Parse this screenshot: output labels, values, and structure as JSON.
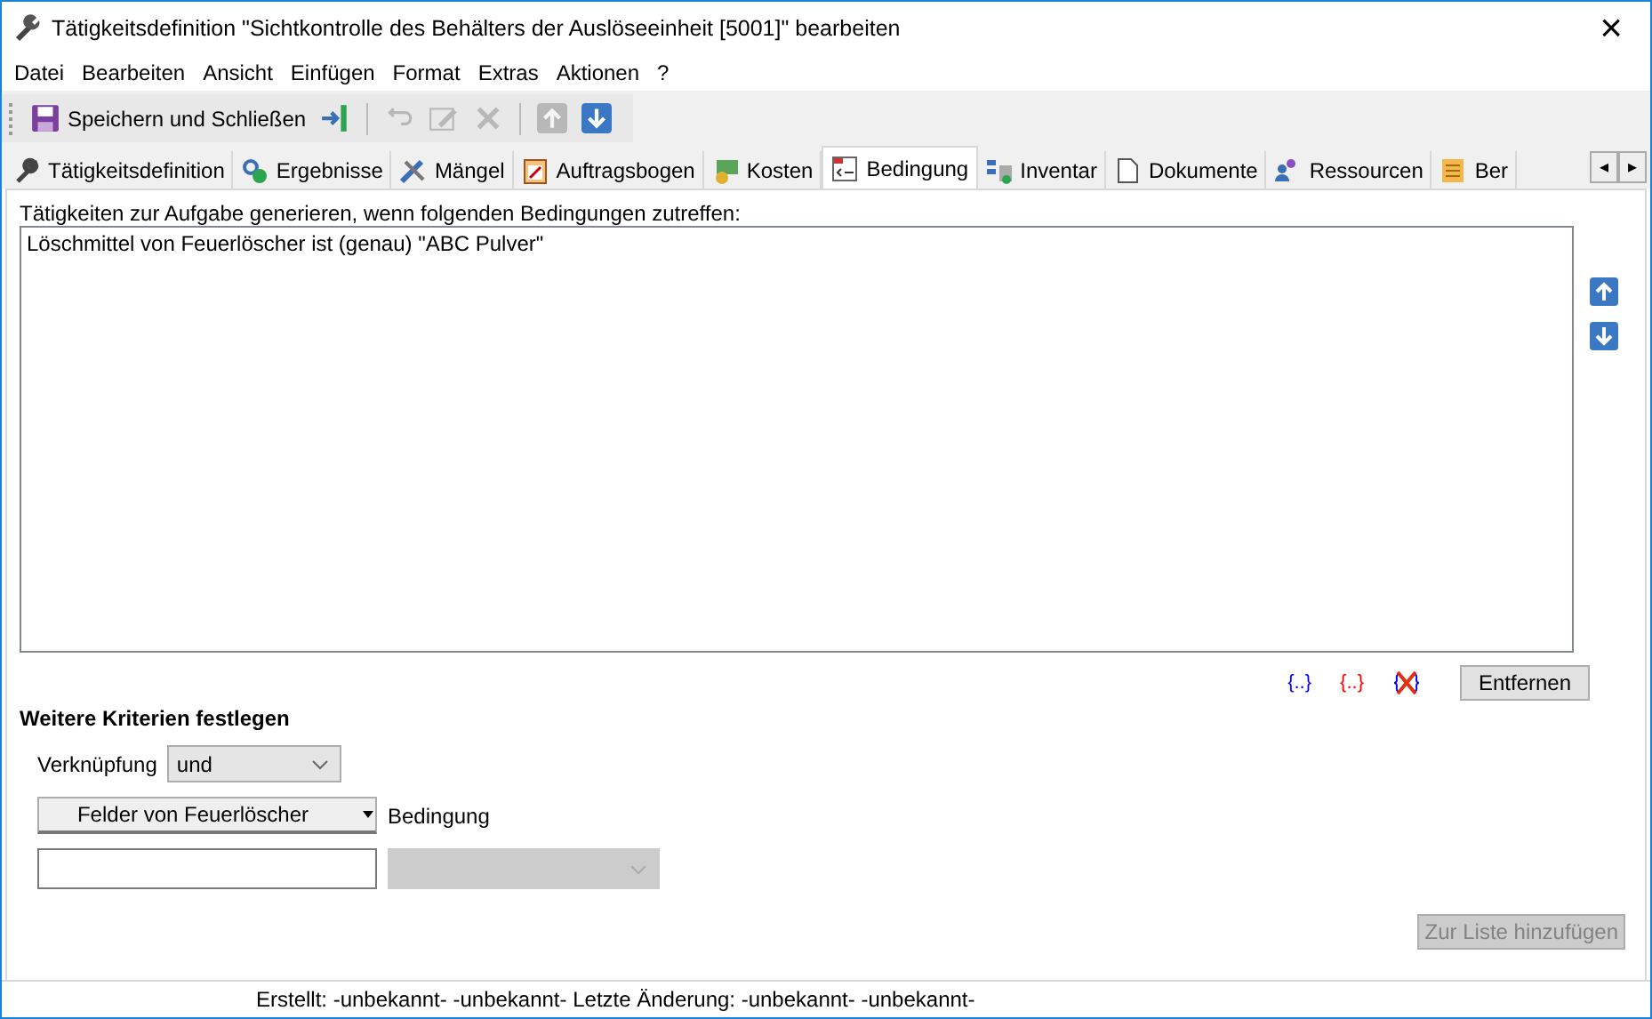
{
  "window": {
    "title": "Tätigkeitsdefinition \"Sichtkontrolle des Behälters der Auslöseeinheit [5001]\" bearbeiten",
    "close": "×"
  },
  "menu": [
    "Datei",
    "Bearbeiten",
    "Ansicht",
    "Einfügen",
    "Format",
    "Extras",
    "Aktionen",
    "?"
  ],
  "toolbar": [
    {
      "kind": "save",
      "label": "Speichern und Schließen",
      "disabled": false
    },
    {
      "kind": "exit",
      "disabled": false
    },
    {
      "kind": "undo",
      "disabled": true
    },
    {
      "kind": "edit",
      "disabled": true
    },
    {
      "kind": "delete",
      "disabled": true
    },
    {
      "kind": "up",
      "disabled": true
    },
    {
      "kind": "down",
      "disabled": false
    }
  ],
  "tabs": [
    {
      "label": "Tätigkeitsdefinition",
      "kind": "wrench",
      "selected": false
    },
    {
      "label": "Ergebnisse",
      "kind": "link",
      "selected": false
    },
    {
      "label": "Mängel",
      "kind": "tools",
      "selected": false
    },
    {
      "label": "Auftragsbogen",
      "kind": "clipboard",
      "selected": false
    },
    {
      "label": "Kosten",
      "kind": "money",
      "selected": false
    },
    {
      "label": "Bedingung",
      "kind": "condition",
      "selected": true
    },
    {
      "label": "Inventar",
      "kind": "inventory",
      "selected": false
    },
    {
      "label": "Dokumente",
      "kind": "document",
      "selected": false
    },
    {
      "label": "Ressourcen",
      "kind": "people",
      "selected": false
    },
    {
      "label": "Ber",
      "kind": "notes",
      "selected": false
    }
  ],
  "tab_scroll": [
    "◂",
    "▸"
  ],
  "conditions": {
    "label": "Tätigkeiten zur Aufgabe generieren, wenn folgenden Bedingungen zutreffen:",
    "items": [
      "Löschmittel von Feuerlöscher ist (genau) \"ABC Pulver\""
    ]
  },
  "condition_tools": [
    {
      "kind": "bracket",
      "label": "{..}",
      "color": "#0000ff"
    },
    {
      "kind": "bracket",
      "label": "{..}",
      "color": "#ff0000"
    },
    {
      "kind": "remove-bracket"
    }
  ],
  "remove_button": "Entfernen",
  "criteria": {
    "title": "Weitere Kriterien festlegen",
    "link_label": "Verknüpfung",
    "link_value": "und",
    "fields_button": "Felder von Feuerlöscher",
    "condition_label": "Bedingung",
    "condition_disabled": true,
    "add_button": "Zur Liste hinzufügen",
    "add_disabled": true
  },
  "status_bar": "Erstellt: -unbekannt- -unbekannt-  Letzte Änderung: -unbekannt- -unbekannt-"
}
